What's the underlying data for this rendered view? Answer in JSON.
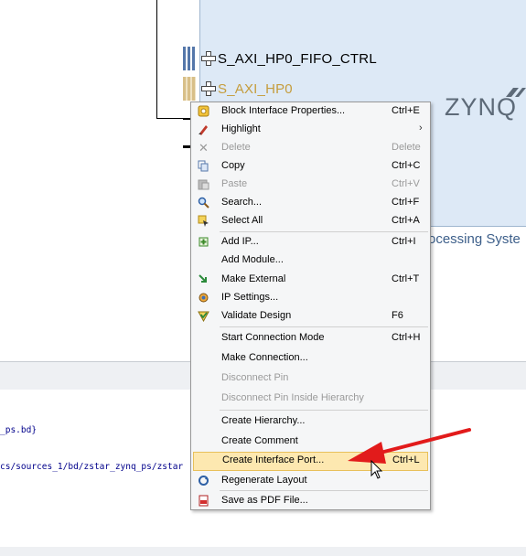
{
  "canvas": {
    "ports": [
      {
        "label": "S_AXI_HP0_FIFO_CTRL"
      },
      {
        "label": "S_AXI_HP0"
      }
    ],
    "logo_text": "ZYNQ",
    "block_subtitle": "ocessing Syste"
  },
  "console": {
    "lines": [
      "_ps.bd}",
      "cs/sources_1/bd/zstar_zynq_ps/zstar"
    ]
  },
  "context_menu": {
    "items": [
      {
        "label": "Block Interface Properties...",
        "shortcut": "Ctrl+E",
        "icon": "properties-icon",
        "enabled": true
      },
      {
        "label": "Highlight",
        "shortcut": "",
        "icon": "highlight-pen-icon",
        "enabled": true,
        "submenu": true
      },
      {
        "label": "Delete",
        "shortcut": "Delete",
        "icon": "delete-x-icon",
        "enabled": false
      },
      {
        "label": "Copy",
        "shortcut": "Ctrl+C",
        "icon": "copy-icon",
        "enabled": true
      },
      {
        "label": "Paste",
        "shortcut": "Ctrl+V",
        "icon": "paste-icon",
        "enabled": false
      },
      {
        "label": "Search...",
        "shortcut": "Ctrl+F",
        "icon": "search-icon",
        "enabled": true
      },
      {
        "label": "Select All",
        "shortcut": "Ctrl+A",
        "icon": "select-all-icon",
        "enabled": true
      },
      {
        "label": "Add IP...",
        "shortcut": "Ctrl+I",
        "icon": "add-ip-icon",
        "enabled": true
      },
      {
        "label": "Add Module...",
        "shortcut": "",
        "icon": "",
        "enabled": true
      },
      {
        "label": "Make External",
        "shortcut": "Ctrl+T",
        "icon": "make-external-icon",
        "enabled": true
      },
      {
        "label": "IP Settings...",
        "shortcut": "",
        "icon": "ip-settings-icon",
        "enabled": true
      },
      {
        "label": "Validate Design",
        "shortcut": "F6",
        "icon": "validate-check-icon",
        "enabled": true
      },
      {
        "label": "Start Connection Mode",
        "shortcut": "Ctrl+H",
        "icon": "",
        "enabled": true
      },
      {
        "label": "Make Connection...",
        "shortcut": "",
        "icon": "",
        "enabled": true
      },
      {
        "label": "Disconnect Pin",
        "shortcut": "",
        "icon": "",
        "enabled": false
      },
      {
        "label": "Disconnect Pin Inside Hierarchy",
        "shortcut": "",
        "icon": "",
        "enabled": false
      },
      {
        "label": "Create Hierarchy...",
        "shortcut": "",
        "icon": "",
        "enabled": true
      },
      {
        "label": "Create Comment",
        "shortcut": "",
        "icon": "",
        "enabled": true
      },
      {
        "label": "Create Interface Port...",
        "shortcut": "Ctrl+L",
        "icon": "",
        "enabled": true,
        "highlighted": true
      },
      {
        "label": "Regenerate Layout",
        "shortcut": "",
        "icon": "regenerate-icon",
        "enabled": true
      },
      {
        "label": "Save as PDF File...",
        "shortcut": "",
        "icon": "pdf-icon",
        "enabled": true
      }
    ]
  },
  "colors": {
    "block_fill": "#dde9f6",
    "menu_bg": "#f5f6f7",
    "highlight_bg": "#fde8b0",
    "arrow": "#e21b1b",
    "port_tan": "#c59d3d"
  }
}
